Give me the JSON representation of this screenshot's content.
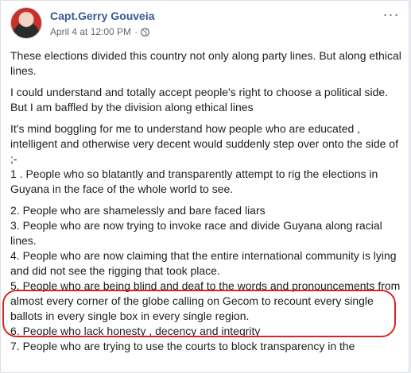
{
  "post": {
    "author": "Capt.Gerry Gouveia",
    "timestamp": "April 4 at 12:00 PM",
    "separator": "·",
    "privacy_icon": "globe-icon",
    "more_icon": "more-options-icon",
    "more_glyph": "···",
    "paragraphs": [
      [
        "These elections divided this country not only along party lines. But along ethical lines."
      ],
      [
        "I could understand and totally accept people's right to choose a political side.",
        "But I am baffled by the division along ethical lines"
      ],
      [
        "It's mind boggling for me to understand how people who are educated , intelligent and otherwise very decent would suddenly step over onto the side of ;-",
        "1 . People who so blatantly and transparently attempt to rig the elections in Guyana in the face of the whole world to see."
      ],
      [
        "2. People who are shamelessly and bare faced liars",
        "3. People who are now trying to invoke race and divide Guyana along racial lines.",
        "4. People who are now claiming that the entire international community is lying and did not see the rigging that took place.",
        "5. People who are being blind and deaf to the words and pronouncements from almost every corner of the globe calling on Gecom to recount every single ballots in every single box in every single region.",
        "6. People who lack honesty , decency and integrity",
        "7. People who are trying to use the courts to block transparency in the"
      ]
    ]
  },
  "colors": {
    "author": "#385898",
    "meta": "#616770",
    "text": "#1c1e21",
    "highlight": "#e0231f"
  }
}
